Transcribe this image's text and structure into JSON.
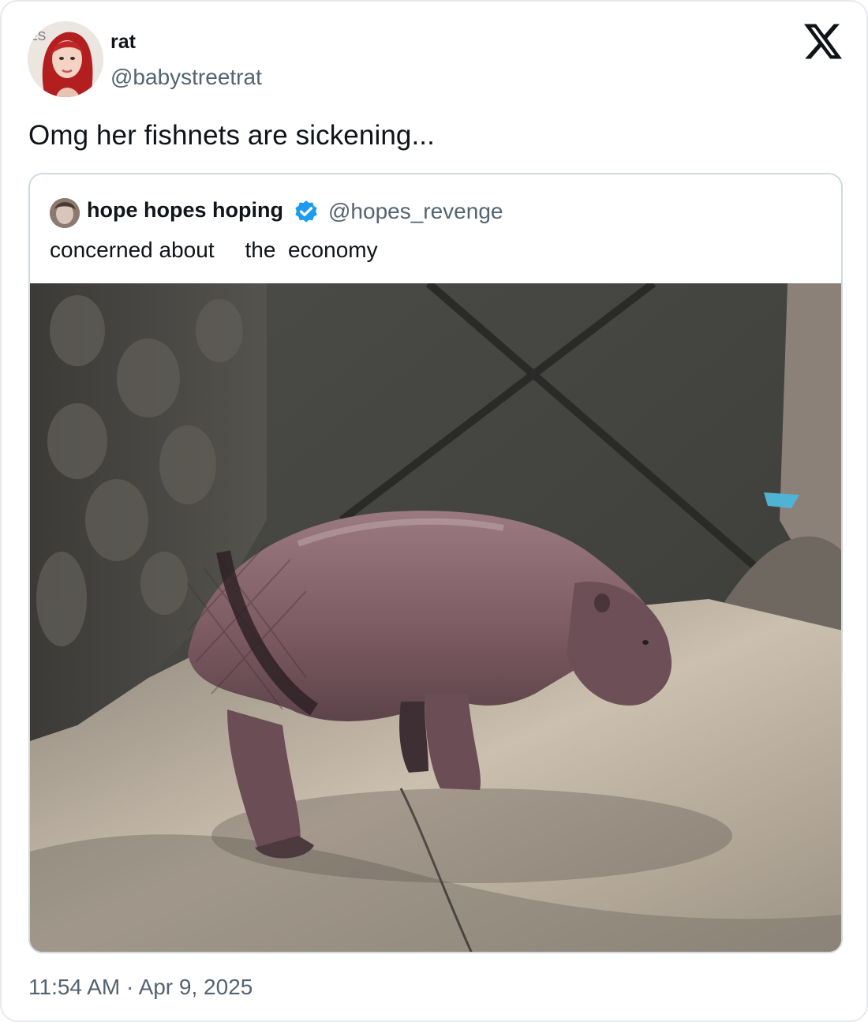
{
  "author": {
    "name": "rat",
    "handle": "@babystreetrat",
    "avatar_icon": "profile-photo"
  },
  "tweet": {
    "text": "Omg her fishnets are sickening...",
    "timestamp": "11:54 AM · Apr 9, 2025"
  },
  "quoted_tweet": {
    "name": "hope hopes hoping",
    "handle": "@hopes_revenge",
    "verified": true,
    "text": "concerned about     the  economy",
    "media_icon": "pygmy-hippo-photo"
  },
  "brand": {
    "logo_icon": "x-logo",
    "verified_color": "#1d9bf0"
  }
}
